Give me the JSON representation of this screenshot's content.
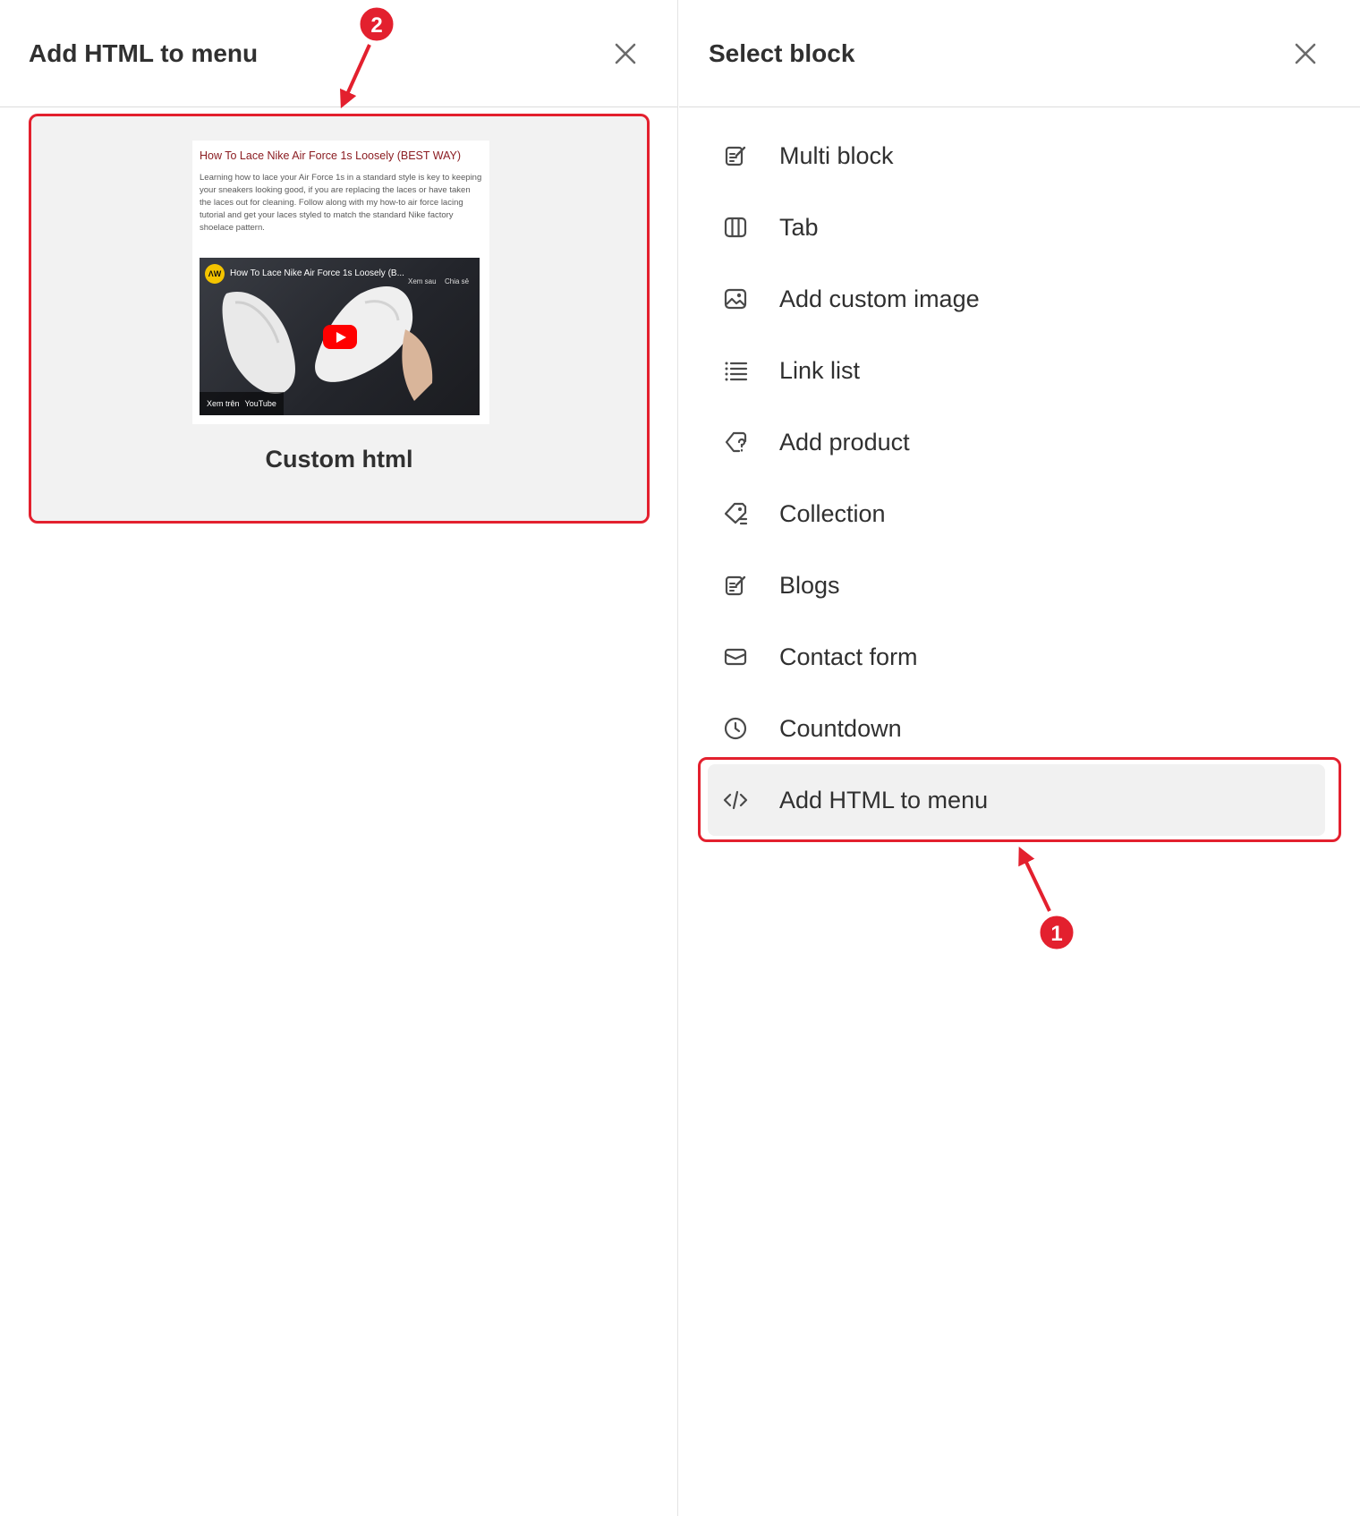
{
  "left_panel": {
    "title": "Add HTML to menu",
    "card": {
      "label": "Custom html",
      "preview": {
        "heading": "How To Lace Nike Air Force 1s Loosely (BEST WAY)",
        "body": "Learning how to lace your Air Force 1s in a standard style is key to keeping your sneakers looking good, if you are replacing the laces or have taken the laces out for cleaning. Follow along with my how-to air force lacing tutorial and get your laces styled to match the standard Nike factory shoelace pattern.",
        "video": {
          "title": "How To Lace Nike Air Force 1s Loosely (B...",
          "channel_initials": "ΛW",
          "watch_later": "Xem sau",
          "share": "Chia sẻ",
          "watch_on": "Xem trên",
          "platform": "YouTube"
        }
      }
    }
  },
  "right_panel": {
    "title": "Select block",
    "items": [
      {
        "label": "Multi block",
        "icon": "edit-note-icon"
      },
      {
        "label": "Tab",
        "icon": "columns-icon"
      },
      {
        "label": "Add custom image",
        "icon": "image-icon"
      },
      {
        "label": "Link list",
        "icon": "list-icon"
      },
      {
        "label": "Add product",
        "icon": "product-tag-icon"
      },
      {
        "label": "Collection",
        "icon": "collection-tag-icon"
      },
      {
        "label": "Blogs",
        "icon": "edit-note-icon"
      },
      {
        "label": "Contact form",
        "icon": "envelope-icon"
      },
      {
        "label": "Countdown",
        "icon": "clock-icon"
      },
      {
        "label": "Add HTML to menu",
        "icon": "code-icon",
        "selected": true
      }
    ]
  },
  "annotations": [
    {
      "number": "1",
      "color": "#e3202e"
    },
    {
      "number": "2",
      "color": "#e3202e"
    }
  ]
}
